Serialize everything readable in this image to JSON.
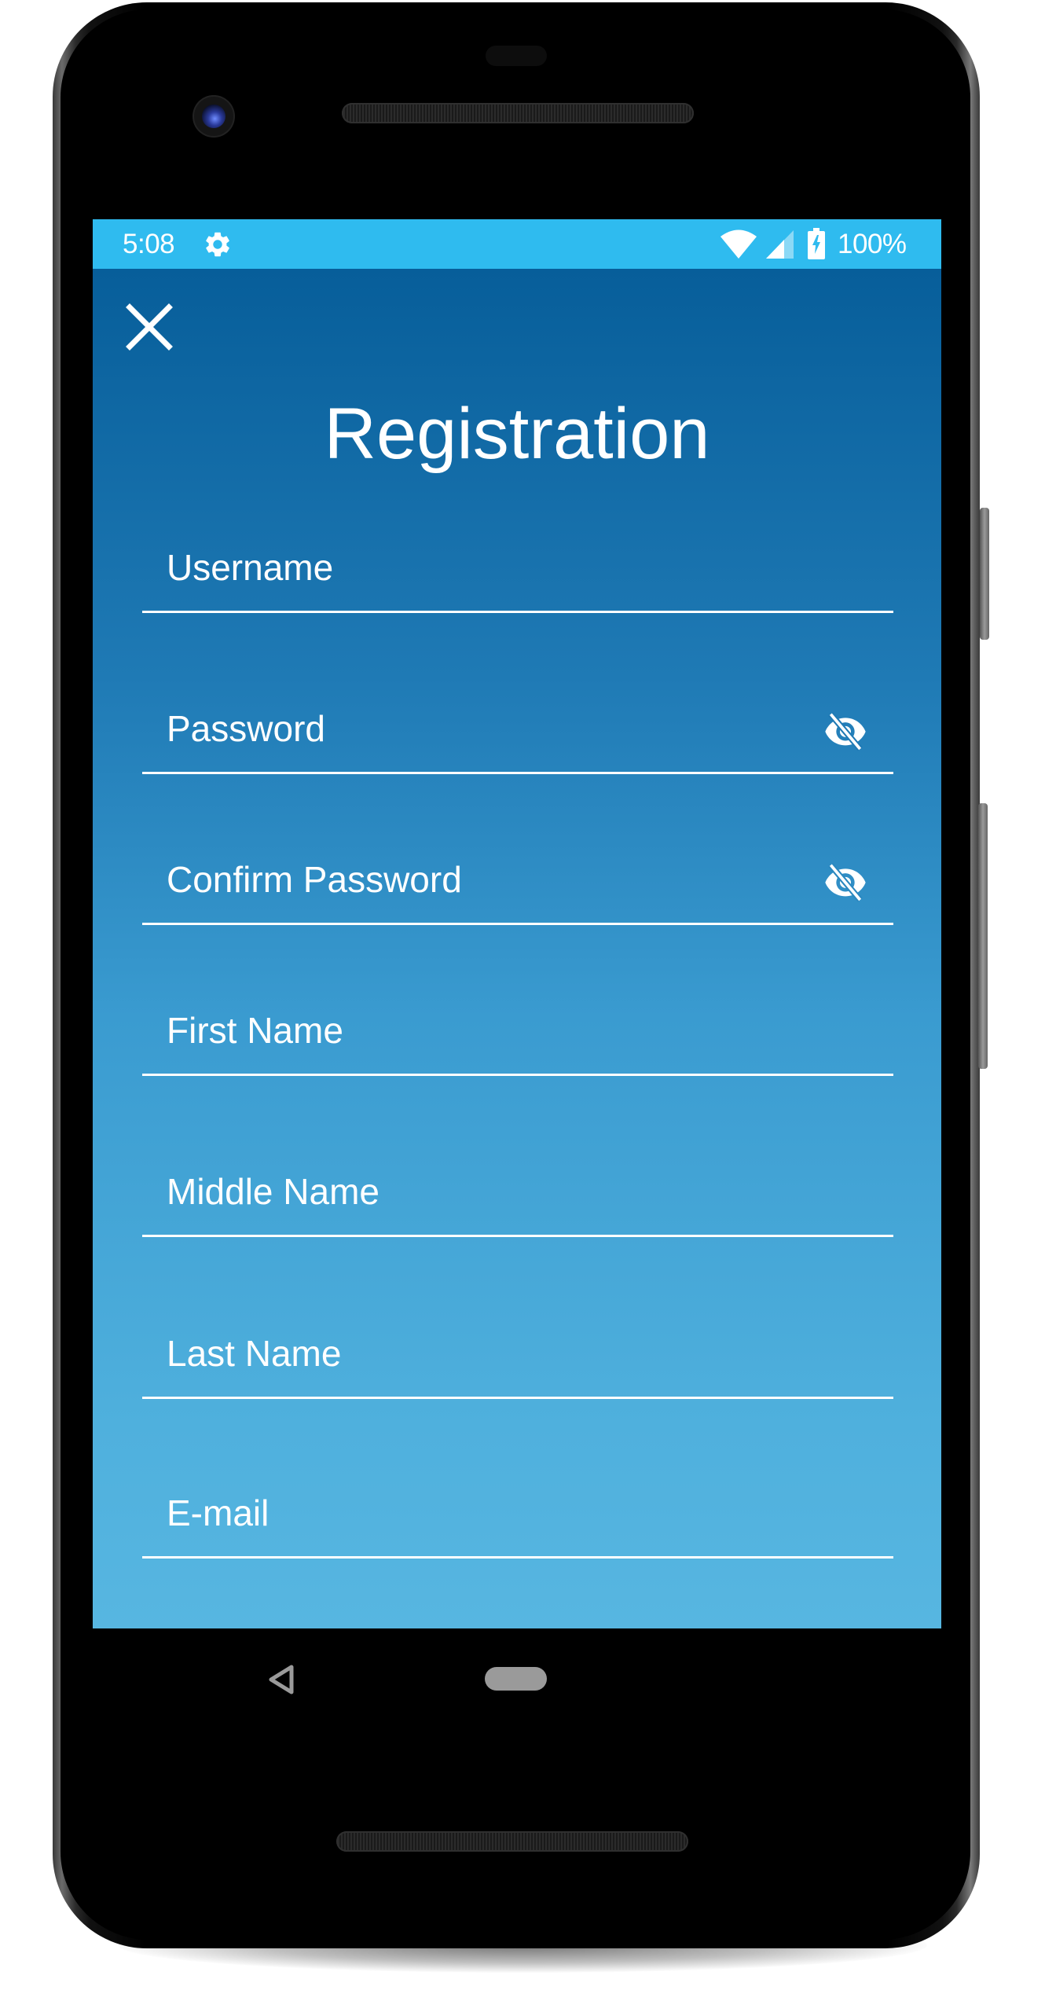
{
  "status_bar": {
    "time": "5:08",
    "battery_percent": "100%",
    "icons": [
      "settings-icon",
      "wifi-icon",
      "signal-icon",
      "battery-charging-icon"
    ],
    "color": "#2fbbef"
  },
  "app": {
    "title": "Registration",
    "close_icon": "close-icon",
    "gradient_top": "#075e9a",
    "gradient_bottom": "#57b6e1",
    "fields": [
      {
        "label": "Username",
        "value": "",
        "has_visibility_toggle": false
      },
      {
        "label": "Password",
        "value": "",
        "has_visibility_toggle": true,
        "visibility_icon": "eye-off-icon"
      },
      {
        "label": "Confirm Password",
        "value": "",
        "has_visibility_toggle": true,
        "visibility_icon": "eye-off-icon"
      },
      {
        "label": "First Name",
        "value": "",
        "has_visibility_toggle": false
      },
      {
        "label": "Middle Name",
        "value": "",
        "has_visibility_toggle": false
      },
      {
        "label": "Last Name",
        "value": "",
        "has_visibility_toggle": false
      },
      {
        "label": "E-mail",
        "value": "",
        "has_visibility_toggle": false
      }
    ]
  },
  "nav_bar": {
    "back_icon": "back-triangle-icon",
    "home_icon": "home-pill-icon"
  }
}
